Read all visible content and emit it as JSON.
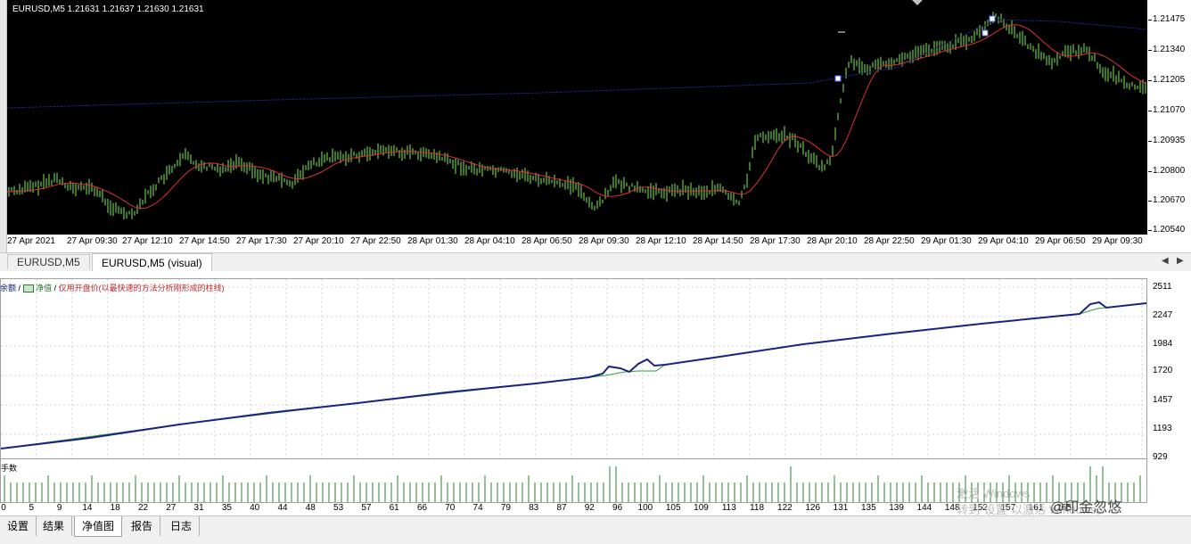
{
  "chart": {
    "caption": "EURUSD,M5  1.21631 1.21637 1.21630 1.21631",
    "colors": {
      "background": "#000000",
      "candle": "#6cc644",
      "ma_fast": "#e03030",
      "ma_slow": "#1a237e"
    },
    "price_labels": [
      "1.21475",
      "1.21340",
      "1.21205",
      "1.21070",
      "1.20935",
      "1.20800",
      "1.20670",
      "1.20540"
    ],
    "time_labels": [
      "27 Apr 2021",
      "27 Apr 09:30",
      "27 Apr 12:10",
      "27 Apr 14:50",
      "27 Apr 17:30",
      "27 Apr 20:10",
      "27 Apr 22:50",
      "28 Apr 01:30",
      "28 Apr 04:10",
      "28 Apr 06:50",
      "28 Apr 09:30",
      "28 Apr 12:10",
      "28 Apr 14:50",
      "28 Apr 17:30",
      "28 Apr 20:10",
      "28 Apr 22:50",
      "29 Apr 01:30",
      "29 Apr 04:10",
      "29 Apr 06:50",
      "29 Apr 09:30"
    ]
  },
  "chart_tabs": [
    {
      "label": "EURUSD,M5"
    },
    {
      "label": "EURUSD,M5 (visual)"
    }
  ],
  "report": {
    "legend": {
      "balance": "余额",
      "sep1": "/",
      "equity": "净值",
      "sep2": "/",
      "note": "仅用开盘价(以最快速的方法分析刚形成的柱线)"
    },
    "lots_label": "手数",
    "equity_labels": [
      "2511",
      "2247",
      "1984",
      "1720",
      "1457",
      "1193",
      "929"
    ],
    "trade_labels": [
      "0",
      "5",
      "9",
      "14",
      "18",
      "22",
      "27",
      "31",
      "35",
      "40",
      "44",
      "48",
      "53",
      "57",
      "61",
      "66",
      "70",
      "74",
      "79",
      "83",
      "87",
      "92",
      "96",
      "100",
      "105",
      "109",
      "113",
      "118",
      "122",
      "126",
      "131",
      "135",
      "139",
      "144",
      "148",
      "152",
      "157",
      "161",
      "165"
    ]
  },
  "bottom_tabs": [
    "设置",
    "结果",
    "净值图",
    "报告",
    "日志"
  ],
  "active_bottom_tab": "净值图",
  "watermark": {
    "line1": "激活 Windows",
    "line2": "转到\"设置\"以激活 Windows。",
    "brand": "@印金忽悠"
  }
}
